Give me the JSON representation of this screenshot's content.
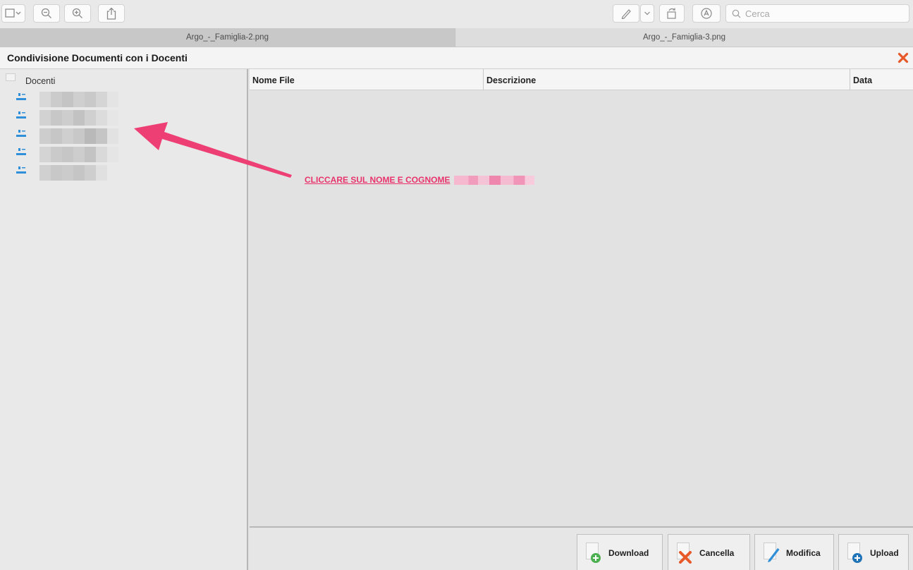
{
  "toolbar": {
    "search_placeholder": "Cerca",
    "icons": [
      "sidebar-toggle-icon",
      "zoom-out-icon",
      "zoom-in-icon",
      "share-icon",
      "pen-icon",
      "chevron-down-icon",
      "rotate-icon",
      "markup-icon",
      "search-icon"
    ]
  },
  "tabs": [
    {
      "label": "Argo_-_Famiglia-2.png",
      "active": true
    },
    {
      "label": "Argo_-_Famiglia-3.png",
      "active": false
    }
  ],
  "window": {
    "title": "Condivisione Documenti con i Docenti",
    "close_icon_color": "#e8592a"
  },
  "tree": {
    "root_label": "Docenti",
    "items_count_visible": 5
  },
  "grid": {
    "columns": [
      "Nome File",
      "Descrizione",
      "Data"
    ]
  },
  "annotation": {
    "text": "CLICCARE SUL NOME E COGNOME",
    "color": "#e8336c"
  },
  "actions": [
    {
      "label": "Download",
      "icon": "download-icon"
    },
    {
      "label": "Cancella",
      "icon": "delete-icon"
    },
    {
      "label": "Modifica",
      "icon": "edit-icon"
    },
    {
      "label": "Upload",
      "icon": "upload-icon"
    }
  ]
}
